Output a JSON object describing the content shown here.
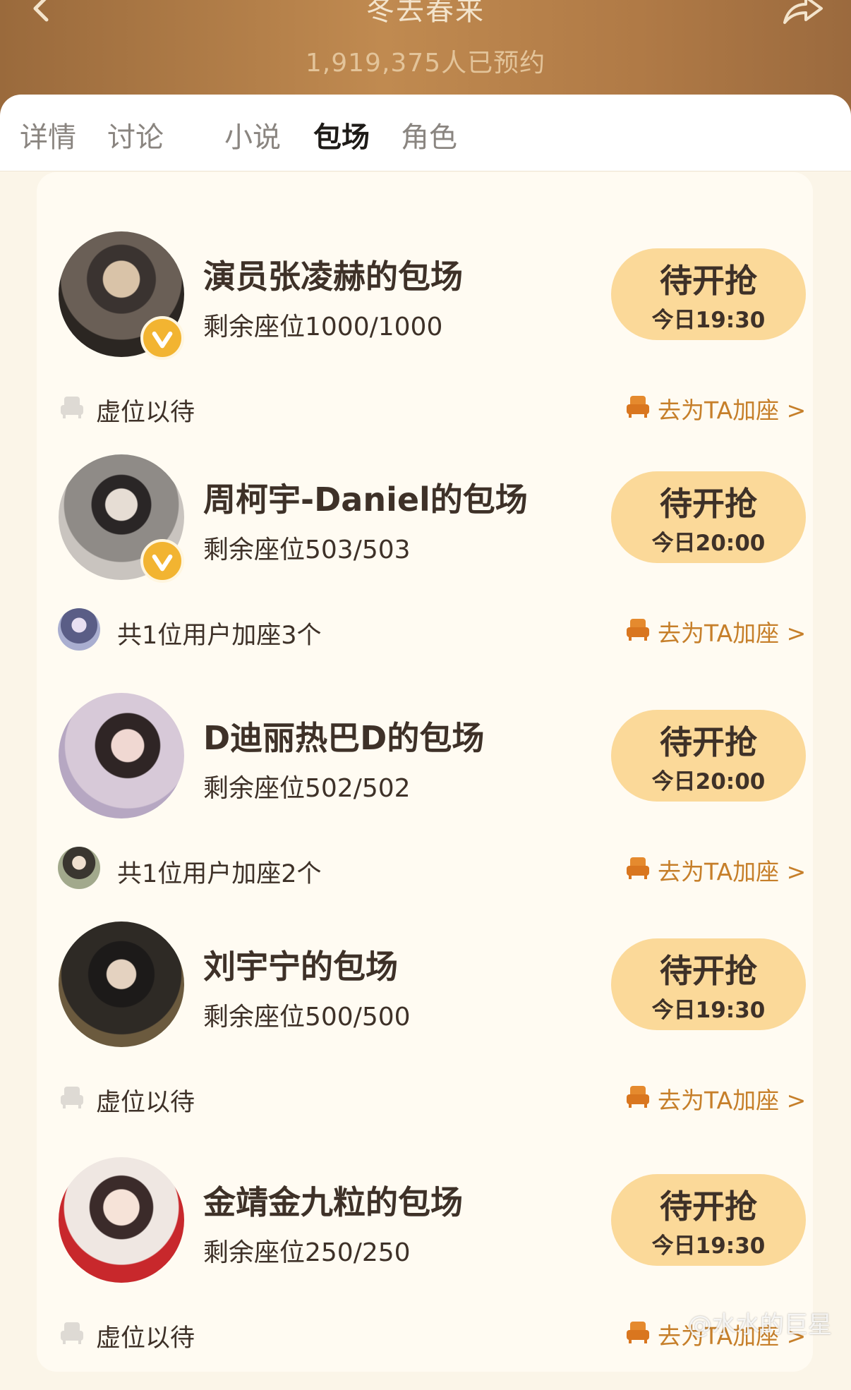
{
  "header": {
    "title": "冬去春来",
    "reservations": "1,919,375人已预约",
    "back_icon": "chevron-left-icon",
    "share_icon": "share-icon"
  },
  "tabs": [
    {
      "label": "详情",
      "active": false
    },
    {
      "label": "讨论",
      "active": false
    },
    {
      "label": "小说",
      "active": false
    },
    {
      "label": "包场",
      "active": true
    },
    {
      "label": "角色",
      "active": false
    }
  ],
  "cards": [
    {
      "title": "演员张凌赫的包场",
      "seats": "剩余座位1000/1000",
      "button": "待开抢",
      "time": "今日19:30",
      "verified": true,
      "footer_type": "empty",
      "footer_text": "虚位以待",
      "add_seat": "去为TA加座 >"
    },
    {
      "title": "周柯宇-Daniel的包场",
      "seats": "剩余座位503/503",
      "button": "待开抢",
      "time": "今日20:00",
      "verified": true,
      "footer_type": "users",
      "footer_text": "共1位用户加座3个",
      "add_seat": "去为TA加座 >"
    },
    {
      "title": "D迪丽热巴D的包场",
      "seats": "剩余座位502/502",
      "button": "待开抢",
      "time": "今日20:00",
      "verified": false,
      "footer_type": "users",
      "footer_text": "共1位用户加座2个",
      "add_seat": "去为TA加座 >"
    },
    {
      "title": "刘宇宁的包场",
      "seats": "剩余座位500/500",
      "button": "待开抢",
      "time": "今日19:30",
      "verified": false,
      "footer_type": "empty",
      "footer_text": "虚位以待",
      "add_seat": "去为TA加座 >"
    },
    {
      "title": "金靖金九粒的包场",
      "seats": "剩余座位250/250",
      "button": "待开抢",
      "time": "今日19:30",
      "verified": false,
      "footer_type": "empty",
      "footer_text": "虚位以待",
      "add_seat": "去为TA加座 >"
    }
  ],
  "watermark": "@水水的巨星",
  "colors": {
    "accent": "#c67f2a",
    "button_bg": "#fbd999",
    "verified_badge": "#f2b431",
    "text_dark": "#3e3128"
  }
}
